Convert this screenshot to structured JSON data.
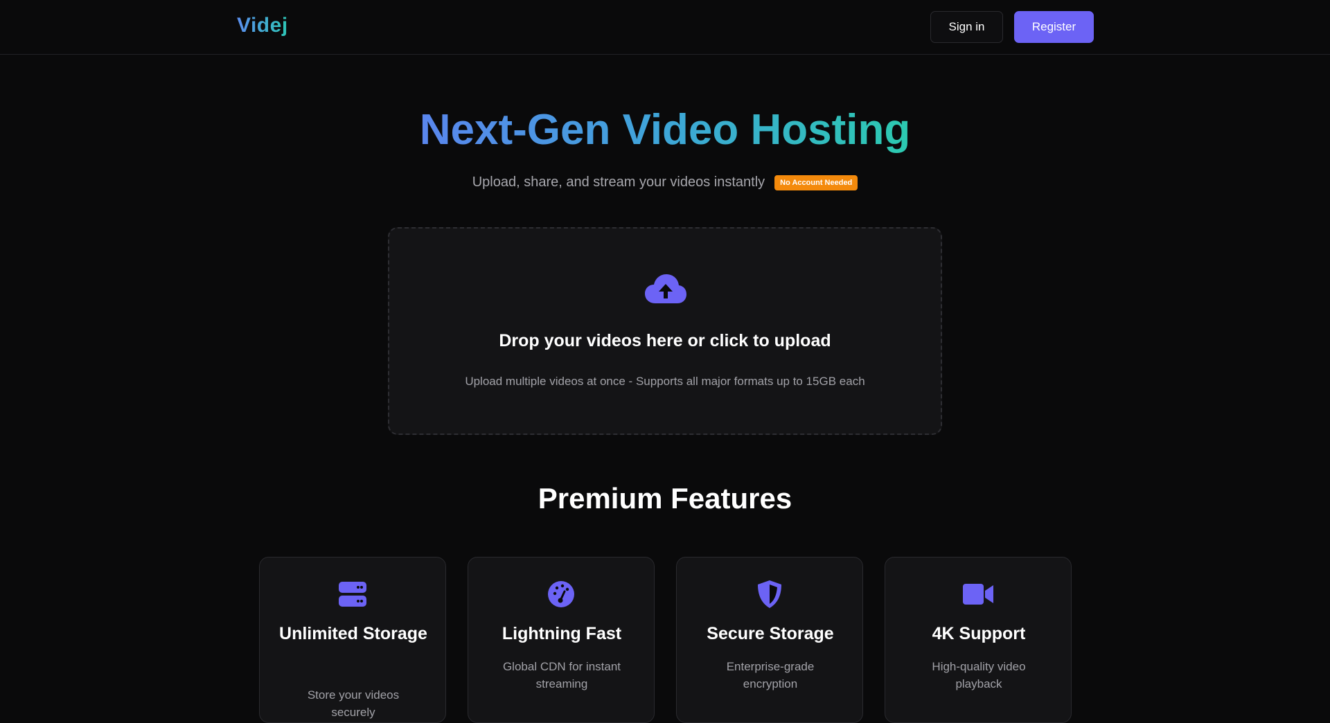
{
  "header": {
    "logo": "Videj",
    "signin_label": "Sign in",
    "register_label": "Register"
  },
  "hero": {
    "title": "Next-Gen Video Hosting",
    "subtitle": "Upload, share, and stream your videos instantly",
    "badge": "No Account Needed"
  },
  "upload": {
    "icon": "cloud-upload-icon",
    "title": "Drop your videos here or click to upload",
    "description": "Upload multiple videos at once - Supports all major formats up to 15GB each"
  },
  "features": {
    "title": "Premium Features",
    "items": [
      {
        "icon": "server-icon",
        "title": "Unlimited Storage",
        "description": "Store your videos securely"
      },
      {
        "icon": "speedometer-icon",
        "title": "Lightning Fast",
        "description": "Global CDN for instant streaming"
      },
      {
        "icon": "shield-icon",
        "title": "Secure Storage",
        "description": "Enterprise-grade encryption"
      },
      {
        "icon": "video-camera-icon",
        "title": "4K Support",
        "description": "High-quality video playback"
      }
    ]
  },
  "colors": {
    "background": "#0a0a0b",
    "accent": "#6c63f5",
    "badge": "#f48a0c",
    "gradient_start": "#5a86ee",
    "gradient_end": "#2ccab0"
  }
}
